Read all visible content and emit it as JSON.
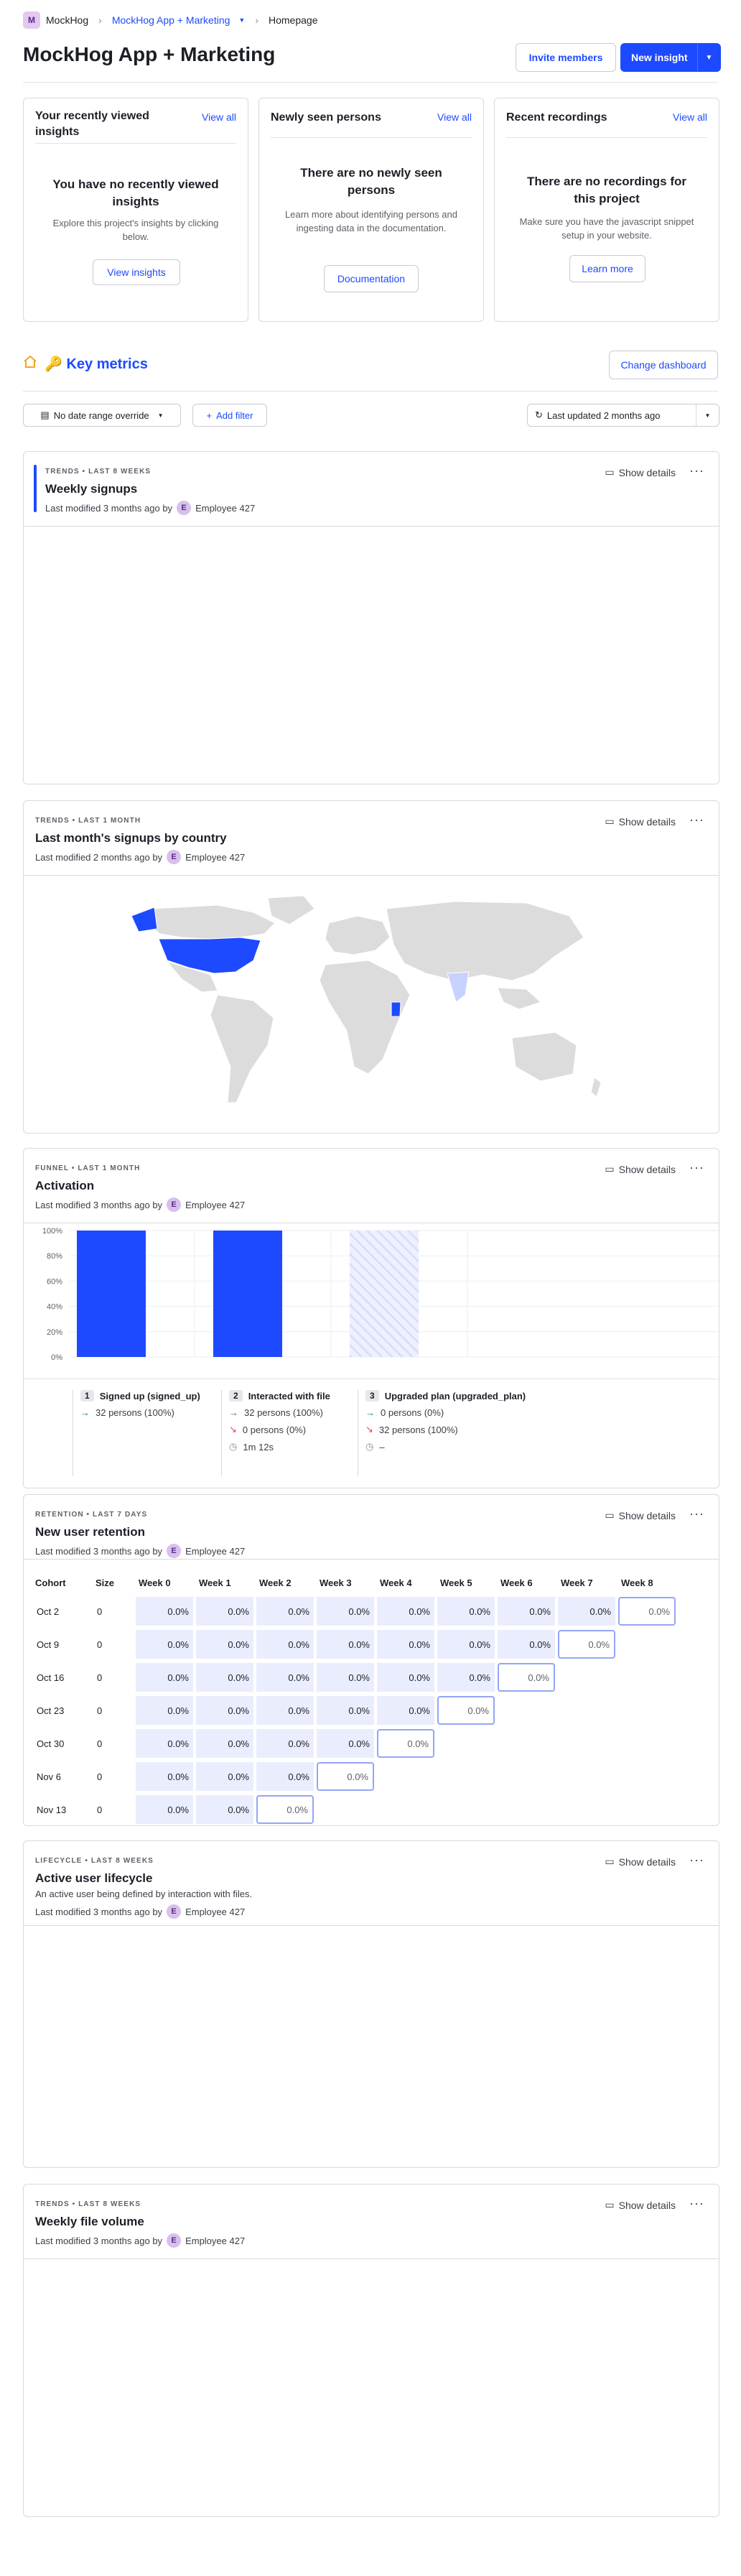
{
  "breadcrumb": {
    "org_initial": "M",
    "org": "MockHog",
    "project": "MockHog App + Marketing",
    "page": "Homepage"
  },
  "header": {
    "title": "MockHog App + Marketing",
    "invite_label": "Invite members",
    "new_insight_label": "New insight"
  },
  "top_cards": [
    {
      "title": "Your recently viewed insights",
      "view_all": "View all",
      "empty_title": "You have no recently viewed insights",
      "empty_desc": "Explore this project's insights by clicking below.",
      "button": "View insights"
    },
    {
      "title": "Newly seen persons",
      "view_all": "View all",
      "empty_title": "There are no newly seen persons",
      "empty_desc": "Learn more about identifying persons and ingesting data in the documentation.",
      "button": "Documentation"
    },
    {
      "title": "Recent recordings",
      "view_all": "View all",
      "empty_title": "There are no recordings for this project",
      "empty_desc": "Make sure you have the javascript snippet setup in your website.",
      "button": "Learn more"
    }
  ],
  "dashboard": {
    "title": "🔑 Key metrics",
    "change_label": "Change dashboard",
    "date_filter": "No date range override",
    "add_filter": "Add filter",
    "last_updated": "Last updated 2 months ago"
  },
  "common": {
    "show_details": "Show details",
    "more": "···",
    "last_modified_3": "Last modified 3 months ago by",
    "last_modified_2": "Last modified 2 months ago by",
    "author_initial": "E",
    "author": "Employee 427"
  },
  "insights": {
    "weekly_signups": {
      "type": "TRENDS • LAST 8 WEEKS",
      "name": "Weekly signups"
    },
    "country": {
      "type": "TRENDS • LAST 1 MONTH",
      "name": "Last month's signups by country"
    },
    "activation": {
      "type": "FUNNEL • LAST 1 MONTH",
      "name": "Activation"
    },
    "retention": {
      "type": "RETENTION • LAST 7 DAYS",
      "name": "New user retention"
    },
    "lifecycle": {
      "type": "LIFECYCLE • LAST 8 WEEKS",
      "name": "Active user lifecycle",
      "description": "An active user being defined by interaction with files."
    },
    "file_volume": {
      "type": "TRENDS • LAST 8 WEEKS",
      "name": "Weekly file volume"
    }
  },
  "funnel": {
    "y_ticks": [
      "100%",
      "80%",
      "60%",
      "40%",
      "20%",
      "0%"
    ],
    "steps": [
      {
        "num": "1",
        "name": "Signed up (signed_up)",
        "value_pct": 100,
        "converted": "32 persons (100%)"
      },
      {
        "num": "2",
        "name": "Interacted with file",
        "value_pct": 100,
        "converted": "32 persons (100%)",
        "dropped": "0 persons (0%)",
        "time": "1m 12s"
      },
      {
        "num": "3",
        "name": "Upgraded plan (upgraded_plan)",
        "value_pct": 0,
        "converted": "0 persons (0%)",
        "dropped": "32 persons (100%)",
        "time": "–"
      }
    ]
  },
  "retention": {
    "headers": [
      "Cohort",
      "Size",
      "Week 0",
      "Week 1",
      "Week 2",
      "Week 3",
      "Week 4",
      "Week 5",
      "Week 6",
      "Week 7",
      "Week 8"
    ],
    "rows": [
      {
        "cohort": "Oct 2",
        "size": "0",
        "values": [
          "0.0%",
          "0.0%",
          "0.0%",
          "0.0%",
          "0.0%",
          "0.0%",
          "0.0%",
          "0.0%",
          "0.0%"
        ]
      },
      {
        "cohort": "Oct 9",
        "size": "0",
        "values": [
          "0.0%",
          "0.0%",
          "0.0%",
          "0.0%",
          "0.0%",
          "0.0%",
          "0.0%",
          "0.0%"
        ]
      },
      {
        "cohort": "Oct 16",
        "size": "0",
        "values": [
          "0.0%",
          "0.0%",
          "0.0%",
          "0.0%",
          "0.0%",
          "0.0%",
          "0.0%"
        ]
      },
      {
        "cohort": "Oct 23",
        "size": "0",
        "values": [
          "0.0%",
          "0.0%",
          "0.0%",
          "0.0%",
          "0.0%",
          "0.0%"
        ]
      },
      {
        "cohort": "Oct 30",
        "size": "0",
        "values": [
          "0.0%",
          "0.0%",
          "0.0%",
          "0.0%",
          "0.0%"
        ]
      },
      {
        "cohort": "Nov 6",
        "size": "0",
        "values": [
          "0.0%",
          "0.0%",
          "0.0%",
          "0.0%"
        ]
      },
      {
        "cohort": "Nov 13",
        "size": "0",
        "values": [
          "0.0%",
          "0.0%",
          "0.0%"
        ]
      }
    ]
  },
  "colors": {
    "accent": "#1d4aff",
    "map_highlight": "#1d4aff",
    "map_low": "#c7d2fe",
    "map_base": "#dcdcdc"
  }
}
